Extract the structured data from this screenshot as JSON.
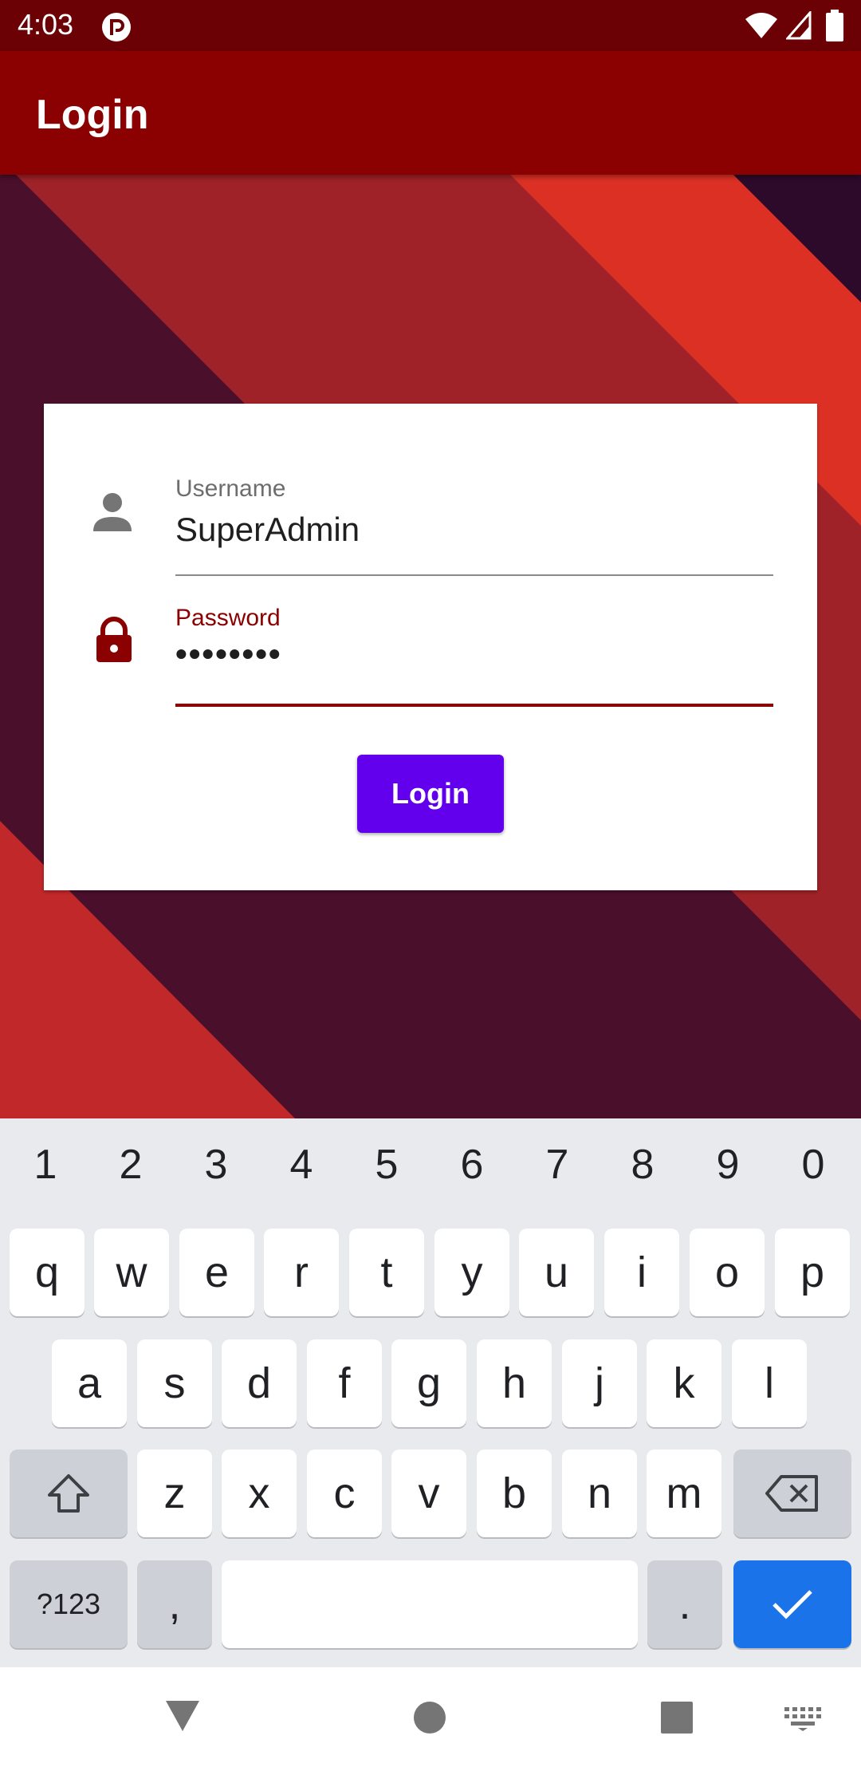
{
  "status_bar": {
    "time": "4:03",
    "icons": [
      "app-notification-icon",
      "wifi-icon",
      "cell-signal-icon",
      "battery-icon"
    ]
  },
  "app_bar": {
    "title": "Login"
  },
  "form": {
    "username": {
      "label": "Username",
      "value": "SuperAdmin",
      "icon": "person-icon"
    },
    "password": {
      "label": "Password",
      "value": "••••••••",
      "icon": "lock-icon"
    },
    "submit_label": "Login"
  },
  "keyboard": {
    "number_row": [
      "1",
      "2",
      "3",
      "4",
      "5",
      "6",
      "7",
      "8",
      "9",
      "0"
    ],
    "row1": [
      "q",
      "w",
      "e",
      "r",
      "t",
      "y",
      "u",
      "i",
      "o",
      "p"
    ],
    "row2": [
      "a",
      "s",
      "d",
      "f",
      "g",
      "h",
      "j",
      "k",
      "l"
    ],
    "row3": [
      "z",
      "x",
      "c",
      "v",
      "b",
      "n",
      "m"
    ],
    "symbols_label": "?123",
    "comma_label": ",",
    "period_label": "."
  },
  "nav_bar": {
    "icons": [
      "back-icon",
      "home-icon",
      "recents-icon",
      "keyboard-switch-icon"
    ]
  },
  "colors": {
    "status_bar": "#6b0005",
    "app_bar": "#8b0000",
    "accent": "#8b0000",
    "button": "#6200ee",
    "enter_key": "#1a73e8"
  }
}
